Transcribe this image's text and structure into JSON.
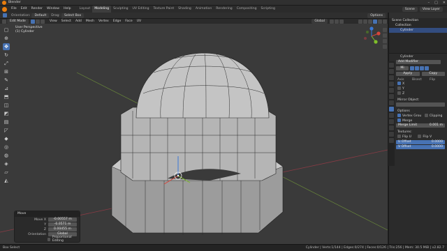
{
  "window": {
    "title": "Blender",
    "controls": [
      "–",
      "□",
      "✕"
    ]
  },
  "menu": [
    "File",
    "Edit",
    "Render",
    "Window",
    "Help"
  ],
  "workspaces": [
    "Layout",
    "Modeling",
    "Sculpting",
    "UV Editing",
    "Texture Paint",
    "Shading",
    "Animation",
    "Rendering",
    "Compositing",
    "Scripting"
  ],
  "active_workspace": "Modeling",
  "topbar": {
    "orientation": "Orientation:",
    "orientation_value": "Default",
    "drag": "Drag:",
    "drag_value": "Select Box",
    "scene": "Scene",
    "view_layer": "View Layer"
  },
  "viewport_header": {
    "mode": "Edit Mode",
    "menus": [
      "View",
      "Select",
      "Add",
      "Mesh",
      "Vertex",
      "Edge",
      "Face",
      "UV"
    ],
    "transform": "Global",
    "options": "Options"
  },
  "viewport": {
    "info_line1": "User Perspective",
    "info_line2": "(1) Cylinder"
  },
  "gizmo": {
    "x": "X",
    "y": "Y",
    "z": "Z"
  },
  "redo": {
    "title": "Move",
    "fields": [
      {
        "label": "Move X",
        "value": "-0.00557 m"
      },
      {
        "label": "Y",
        "value": "-0.0571 m"
      },
      {
        "label": "Z",
        "value": "0.00455 m"
      },
      {
        "label": "Orientation",
        "value": "Global"
      }
    ],
    "check": "Proportional Editing"
  },
  "outliner": {
    "items": [
      "Scene Collection",
      "Collection",
      "Cylinder"
    ]
  },
  "properties": {
    "object": "Cylinder",
    "add_modifier": "Add Modifier",
    "modifier_name": "Mi",
    "apply": "Apply",
    "copy": "Copy",
    "axis_header": [
      "Axis",
      "Bisect",
      "Flip"
    ],
    "axes": [
      "X",
      "Y",
      "Z"
    ],
    "mirror_object": "Mirror Object:",
    "options_header": "Options",
    "vertex_groups": "Vertex Grou",
    "clipping": "Clipping",
    "merge": "Merge",
    "merge_limit_label": "Merge Limit",
    "merge_limit": "0.001 m",
    "textures_header": "Textures:",
    "flip_u": "Flip U",
    "flip_v": "Flip V",
    "u_offset_label": "U Offset",
    "u_offset": "0.0000",
    "v_offset_label": "V Offset",
    "v_offset": "0.0000"
  },
  "statusbar": {
    "left": "Box Select",
    "right": "Cylinder | Verts:1/144 | Edges:0/274 | Faces:0/126 | Tris:256 | Mem: 30.5 MiB | v2.82.7"
  }
}
